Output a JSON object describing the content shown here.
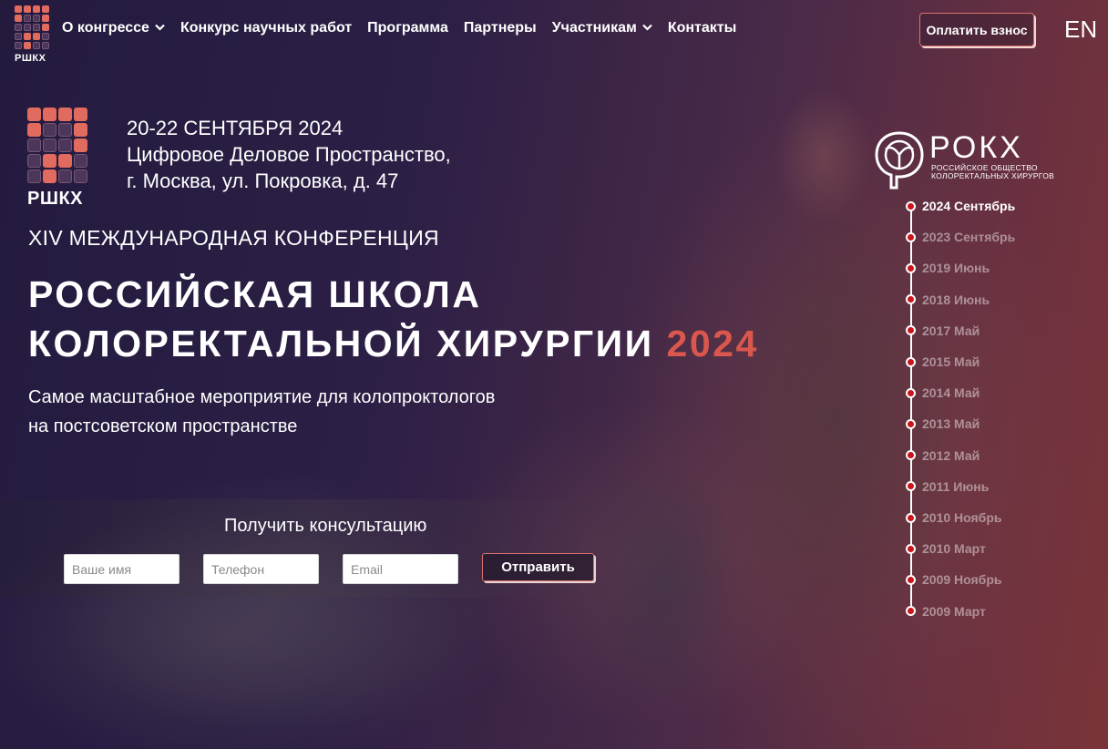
{
  "brand": {
    "short_name": "РШКХ"
  },
  "nav": {
    "items": [
      {
        "label": "О конгрессе",
        "has_dropdown": true
      },
      {
        "label": "Конкурс научных работ",
        "has_dropdown": false
      },
      {
        "label": "Программа",
        "has_dropdown": false
      },
      {
        "label": "Партнеры",
        "has_dropdown": false
      },
      {
        "label": "Участникам",
        "has_dropdown": true
      },
      {
        "label": "Контакты",
        "has_dropdown": false
      }
    ],
    "dropdown_glyph": "❯",
    "pay_label": "Оплатить взнос",
    "lang_label": "EN"
  },
  "event": {
    "dates": "20-22 СЕНТЯБРЯ 2024",
    "venue": "Цифровое Деловое Пространство,",
    "address": "г. Москва, ул. Покровка, д. 47"
  },
  "hero": {
    "subtitle": "XIV МЕЖДУНАРОДНАЯ КОНФЕРЕНЦИЯ",
    "title_line1": "РОССИЙСКАЯ ШКОЛА",
    "title_line2": "КОЛОРЕКТАЛЬНОЙ ХИРУРГИИ",
    "title_year": "2024",
    "tagline_line1": "Самое масштабное мероприятие для колопроктологов",
    "tagline_line2": "на постсоветском пространстве"
  },
  "consult": {
    "title": "Получить консультацию",
    "name_placeholder": "Ваше имя",
    "phone_placeholder": "Телефон",
    "email_placeholder": "Email",
    "submit_label": "Отправить"
  },
  "org": {
    "name": "РОКХ",
    "desc_line1": "РОССИЙСКОЕ ОБЩЕСТВО",
    "desc_line2": "КОЛОРЕКТАЛЬНЫХ ХИРУРГОВ"
  },
  "timeline": {
    "active_index": 0,
    "items": [
      "2024 Сентябрь",
      "2023 Сентябрь",
      "2019 Июнь",
      "2018 Июнь",
      "2017 Май",
      "2015 Май",
      "2014 Май",
      "2013 Май",
      "2012 Май",
      "2011 Июнь",
      "2010 Ноябрь",
      "2010 Март",
      "2009 Ноябрь",
      "2009 Март"
    ]
  },
  "colors": {
    "accent": "#d9574c",
    "timeline_dot": "#c9151c",
    "logo_cell_on": "#e06b5e"
  }
}
